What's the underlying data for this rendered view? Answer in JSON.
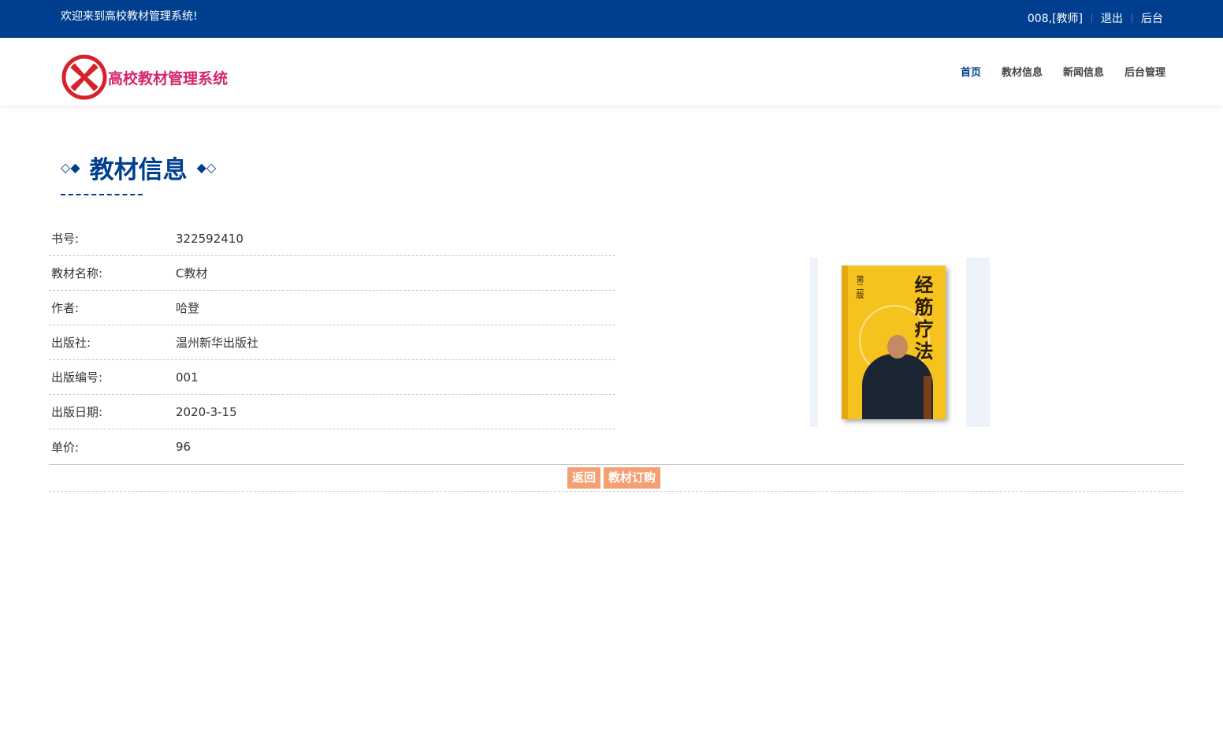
{
  "topbar": {
    "welcome": "欢迎来到高校教材管理系统!",
    "user": "008,[教师]",
    "logout": "退出",
    "backend": "后台"
  },
  "header": {
    "logo_text": "高校教材管理系统",
    "nav": [
      {
        "label": "首页",
        "active": true
      },
      {
        "label": "教材信息",
        "active": false
      },
      {
        "label": "新闻信息",
        "active": false
      },
      {
        "label": "后台管理",
        "active": false
      }
    ]
  },
  "section": {
    "title": "教材信息"
  },
  "details": [
    {
      "label": "书号:",
      "value": "322592410"
    },
    {
      "label": "教材名称:",
      "value": "C教材"
    },
    {
      "label": "作者:",
      "value": "哈登"
    },
    {
      "label": "出版社:",
      "value": "温州新华出版社"
    },
    {
      "label": "出版编号:",
      "value": "001"
    },
    {
      "label": "出版日期:",
      "value": "2020-3-15"
    },
    {
      "label": "单价:",
      "value": "96"
    }
  ],
  "book_image": {
    "cover_title": "经筋疗法",
    "cover_sub": "第二版"
  },
  "actions": {
    "back": "返回",
    "order": "教材订购"
  },
  "colors": {
    "primary": "#003f8f",
    "logo": "#d5266c",
    "button": "#f2a074"
  }
}
